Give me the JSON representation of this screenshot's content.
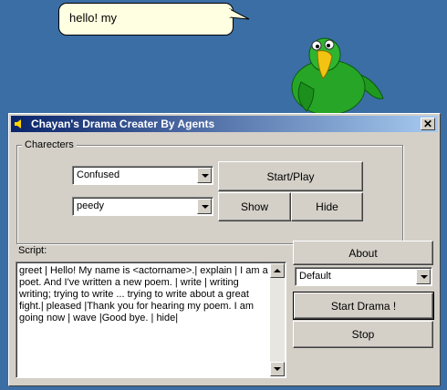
{
  "balloon": {
    "text": "hello! my"
  },
  "window": {
    "title": "Chayan's Drama Creater By Agents",
    "close_label": "✕"
  },
  "characters": {
    "group_label": "Charecters",
    "emotion_select": {
      "value": "Confused"
    },
    "agent_select": {
      "value": "peedy"
    },
    "start_play_label": "Start/Play",
    "show_label": "Show",
    "hide_label": "Hide"
  },
  "script": {
    "label": "Script:",
    "text": "greet | Hello! My name is <actorname>.| explain | I am a poet. And I've written a new poem. | write | writing writing; trying to write ... trying to write about a great fight.| pleased |Thank you for hearing my poem. I am going now | wave |Good bye. | hide|"
  },
  "side": {
    "about_label": "About",
    "drama_select": {
      "value": "Default"
    },
    "start_drama_label": "Start Drama !",
    "stop_label": "Stop"
  },
  "colors": {
    "desktop": "#3a6ea5",
    "titlebar_start": "#0a246a",
    "titlebar_end": "#a6caf0",
    "parrot_green": "#1f9a1f"
  },
  "icons": [
    "speaker-icon",
    "close-icon",
    "dropdown-arrow-icon",
    "scroll-up-icon",
    "scroll-down-icon",
    "parrot-character"
  ]
}
